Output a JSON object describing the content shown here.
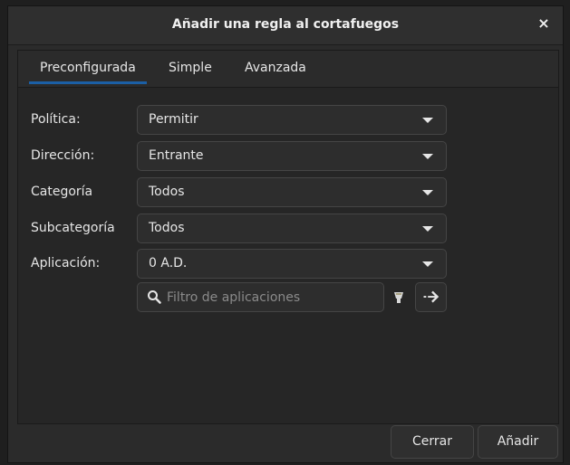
{
  "dialog": {
    "title": "Añadir una regla al cortafuegos",
    "close_icon": "close-icon"
  },
  "tabs": [
    {
      "label": "Preconfigurada",
      "active": true
    },
    {
      "label": "Simple",
      "active": false
    },
    {
      "label": "Avanzada",
      "active": false
    }
  ],
  "form": {
    "policy": {
      "label": "Política:",
      "value": "Permitir"
    },
    "direction": {
      "label": "Dirección:",
      "value": "Entrante"
    },
    "category": {
      "label": "Categoría",
      "value": "Todos"
    },
    "subcategory": {
      "label": "Subcategoría",
      "value": "Todos"
    },
    "application": {
      "label": "Aplicación:",
      "value": "0 A.D."
    },
    "filter": {
      "placeholder": "Filtro de aplicaciones",
      "value": ""
    }
  },
  "buttons": {
    "close": "Cerrar",
    "add": "Añadir"
  },
  "colors": {
    "accent": "#1b5fa5",
    "background": "#2b2b2b"
  }
}
